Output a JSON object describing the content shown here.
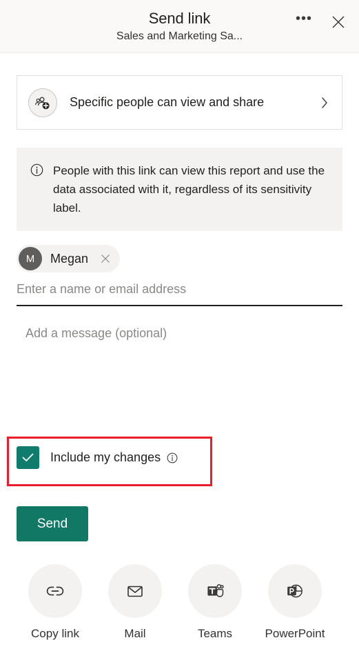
{
  "header": {
    "title": "Send link",
    "subtitle": "Sales and Marketing Sa...",
    "more_label": "•••",
    "more_name": "more-options",
    "close_name": "close"
  },
  "permission": {
    "label": "Specific people can view and share",
    "icon": "people-add-icon",
    "chevron": "chevron-right-icon"
  },
  "info_banner": {
    "icon": "info-icon",
    "text": "People with this link can view this report and use the data associated with it, regardless of its sensitivity label."
  },
  "recipients": {
    "pills": [
      {
        "initial": "M",
        "name": "Megan",
        "remove_icon": "close-icon"
      }
    ],
    "name_input_placeholder": "Enter a name or email address",
    "name_input_value": ""
  },
  "message": {
    "placeholder": "Add a message (optional)",
    "value": ""
  },
  "include_changes": {
    "label": "Include my changes",
    "checked": true,
    "info_icon": "info-icon",
    "highlighted": true,
    "highlight_color": "#ec1c29"
  },
  "send_button": {
    "label": "Send",
    "color": "#117865"
  },
  "share_targets": [
    {
      "label": "Copy link",
      "icon": "link-icon"
    },
    {
      "label": "Mail",
      "icon": "mail-icon"
    },
    {
      "label": "Teams",
      "icon": "teams-icon"
    },
    {
      "label": "PowerPoint",
      "icon": "powerpoint-icon"
    }
  ],
  "colors": {
    "accent_green": "#117865",
    "checkbox_green": "#107c6e",
    "highlight_red": "#ec1c29",
    "panel_gray": "#f3f2f1",
    "header_gray": "#faf9f8"
  }
}
